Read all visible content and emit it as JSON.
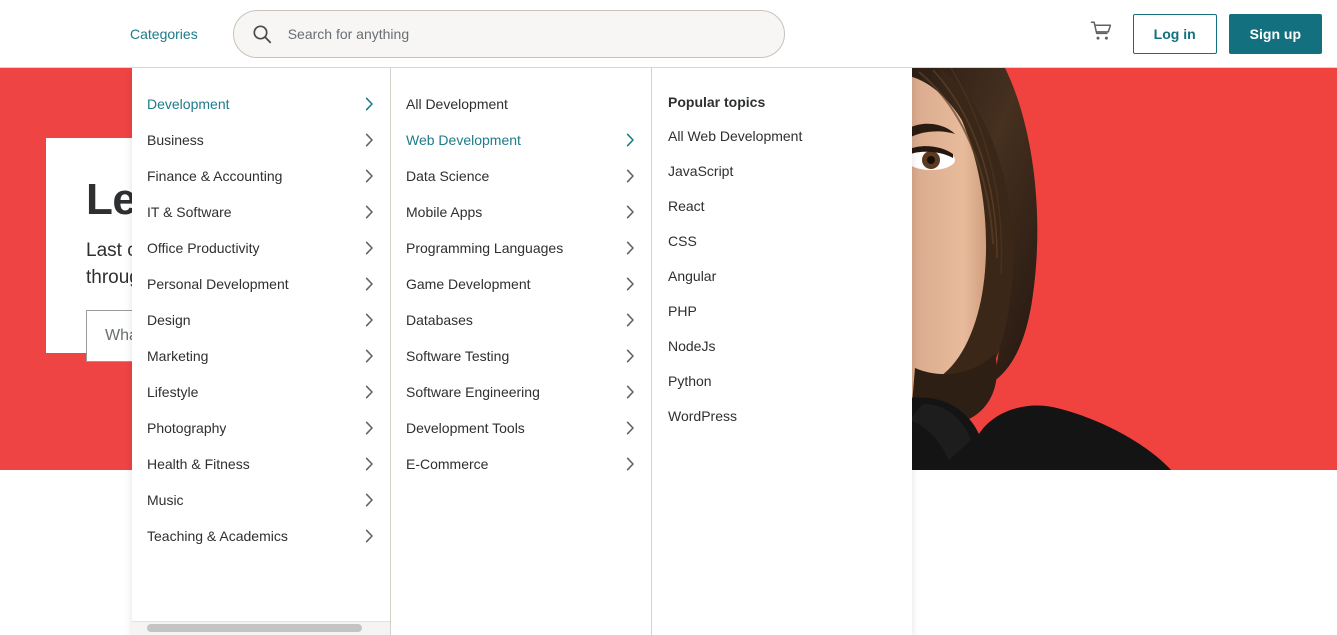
{
  "header": {
    "categories_label": "Categories",
    "search": {
      "placeholder": "Search for anything",
      "value": "",
      "icon": "search-icon"
    },
    "cart_icon": "shopping-cart-icon",
    "login_label": "Log in",
    "signup_label": "Sign up",
    "accent_teal": "#12707f",
    "link_teal": "#1d7b8a"
  },
  "hero": {
    "background_color": "#ef4444",
    "title": "Lea",
    "subtitle_line1": "Last cal",
    "subtitle_line2": "through",
    "input_placeholder": "What ",
    "photo_alt": "woman-portrait-photo"
  },
  "megamenu": {
    "column1": {
      "items": [
        {
          "label": "Development",
          "active": true,
          "chevron": true
        },
        {
          "label": "Business",
          "active": false,
          "chevron": true
        },
        {
          "label": "Finance & Accounting",
          "active": false,
          "chevron": true
        },
        {
          "label": "IT & Software",
          "active": false,
          "chevron": true
        },
        {
          "label": "Office Productivity",
          "active": false,
          "chevron": true
        },
        {
          "label": "Personal Development",
          "active": false,
          "chevron": true
        },
        {
          "label": "Design",
          "active": false,
          "chevron": true
        },
        {
          "label": "Marketing",
          "active": false,
          "chevron": true
        },
        {
          "label": "Lifestyle",
          "active": false,
          "chevron": true
        },
        {
          "label": "Photography",
          "active": false,
          "chevron": true
        },
        {
          "label": "Health & Fitness",
          "active": false,
          "chevron": true
        },
        {
          "label": "Music",
          "active": false,
          "chevron": true
        },
        {
          "label": "Teaching & Academics",
          "active": false,
          "chevron": true
        }
      ]
    },
    "column2": {
      "items": [
        {
          "label": "All Development",
          "active": false,
          "chevron": false
        },
        {
          "label": "Web Development",
          "active": true,
          "chevron": true
        },
        {
          "label": "Data Science",
          "active": false,
          "chevron": true
        },
        {
          "label": "Mobile Apps",
          "active": false,
          "chevron": true
        },
        {
          "label": "Programming Languages",
          "active": false,
          "chevron": true
        },
        {
          "label": "Game Development",
          "active": false,
          "chevron": true
        },
        {
          "label": "Databases",
          "active": false,
          "chevron": true
        },
        {
          "label": "Software Testing",
          "active": false,
          "chevron": true
        },
        {
          "label": "Software Engineering",
          "active": false,
          "chevron": true
        },
        {
          "label": "Development Tools",
          "active": false,
          "chevron": true
        },
        {
          "label": "E-Commerce",
          "active": false,
          "chevron": true
        }
      ]
    },
    "column3": {
      "heading": "Popular topics",
      "topics": [
        "All Web Development",
        "JavaScript",
        "React",
        "CSS",
        "Angular",
        "PHP",
        "NodeJs",
        "Python",
        "WordPress"
      ]
    }
  }
}
